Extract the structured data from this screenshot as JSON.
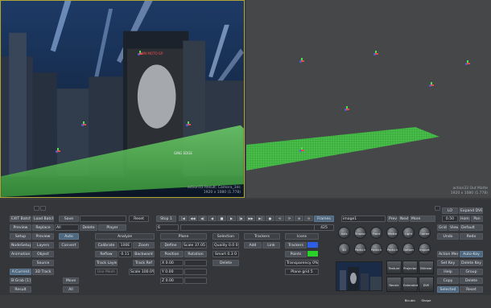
{
  "viewport_left": {
    "info_line1": "action33 Result: Camera_3dc",
    "info_line2": "1920 x 1080 (1.778)",
    "scene_text_top": "WIN MOTO GP",
    "scene_text_bottom": "GING EDGE"
  },
  "viewport_right": {
    "info_line1": "action33 Out Matte",
    "info_line2": "1920 x 1080 (1.778)"
  },
  "toolbar": {
    "exit": "EXIT Batch",
    "load": "Load Batch",
    "save": "Save",
    "reset": "Reset",
    "stop": "Stop 1",
    "frames": "Frames",
    "frame_num": "6",
    "frame_end": "425",
    "node_name": "image1",
    "prev": "Prev",
    "next": "Next",
    "mode": "More",
    "lo": "LO",
    "expand": "Expand DVE",
    "zoom": "0.50",
    "home": "Home",
    "pan": "Pan"
  },
  "left_col": {
    "preview": "Preview",
    "replace": "Replace",
    "all": "All",
    "auto": "Auto",
    "delete": "Delete",
    "player": "Player",
    "setup": "Setup",
    "preview2": "Preview",
    "nodesetup": "NodeSetup",
    "layers": "Layers",
    "convert": "Convert",
    "animation": "Animation",
    "object": "Object",
    "source": "Source",
    "a_current": "A:Current",
    "d3_track": "3D Track",
    "b_grab": "B:Grab [1]",
    "result": "Result",
    "move": "Move",
    "all2": "All"
  },
  "analyze": {
    "header": "Analyze",
    "calibrate": "Calibrate",
    "calib_val": "100E",
    "zoom": "Zoom",
    "reflow": "Reflow",
    "reflow_val": "0.11",
    "backward": "Backward",
    "track_layer": "Track Layer",
    "track_ref": "Track Ref",
    "use_mesh": "Use Mesh",
    "scale": "Scale 100.0%"
  },
  "plane": {
    "header": "Plane",
    "define": "Define",
    "scale_fov": "Scale 37.05",
    "position": "Position",
    "rotation": "Rotation",
    "x": "X 0.00",
    "y": "Y 0.00",
    "z": "Z 0.00"
  },
  "selection": {
    "header": "Selection",
    "quality": "Quality 0.0 0",
    "smart": "Smart 0.3 0",
    "delete": "Delete"
  },
  "trackers": {
    "header": "Trackers",
    "add": "Add",
    "link": "Link"
  },
  "icons": {
    "header": "Icons",
    "trackers": "Trackers",
    "points": "Points",
    "transparency": "Transparency 0%",
    "plane_grid": "Plane grid 5",
    "trackers_color": "#2f5ee6",
    "points_color": "#28d228"
  },
  "nodes": {
    "row1": [
      "Axis",
      "Shadow",
      "Front Source",
      "Matte Source",
      "Light",
      "Camera"
    ],
    "row2": [
      "3D Text",
      "Particle Generator",
      "Particle Animator",
      "Particle Bouncer",
      "Deform",
      "Import"
    ],
    "row3": [
      "Texture",
      "Projector",
      "Bilinear"
    ],
    "row4": [
      "Recalc",
      "Extended Bicubic",
      "DVE Shape"
    ]
  },
  "right_col": {
    "grid": "Grid",
    "view": "View",
    "default": "Default",
    "undo": "Undo",
    "redo": "Redo",
    "action_menu": "Action Menu",
    "auto_key": "Auto-Key",
    "set_key": "Set Key",
    "delete_key": "Delete Key",
    "help": "Help",
    "group": "Group",
    "copy": "Copy",
    "delete": "Delete",
    "selected": "Selected",
    "reset": "Reset"
  },
  "transport": [
    "|◀",
    "◀◀",
    "◀|",
    "◀",
    "■",
    "▶",
    "|▶",
    "▶▶",
    "▶|",
    "●",
    "⟲",
    "⟳",
    "⊕",
    "⊖"
  ],
  "colors": {
    "accent_blue": "#4e6880",
    "grid_green": "#3fc93f",
    "selected_border": "#b0a435"
  }
}
